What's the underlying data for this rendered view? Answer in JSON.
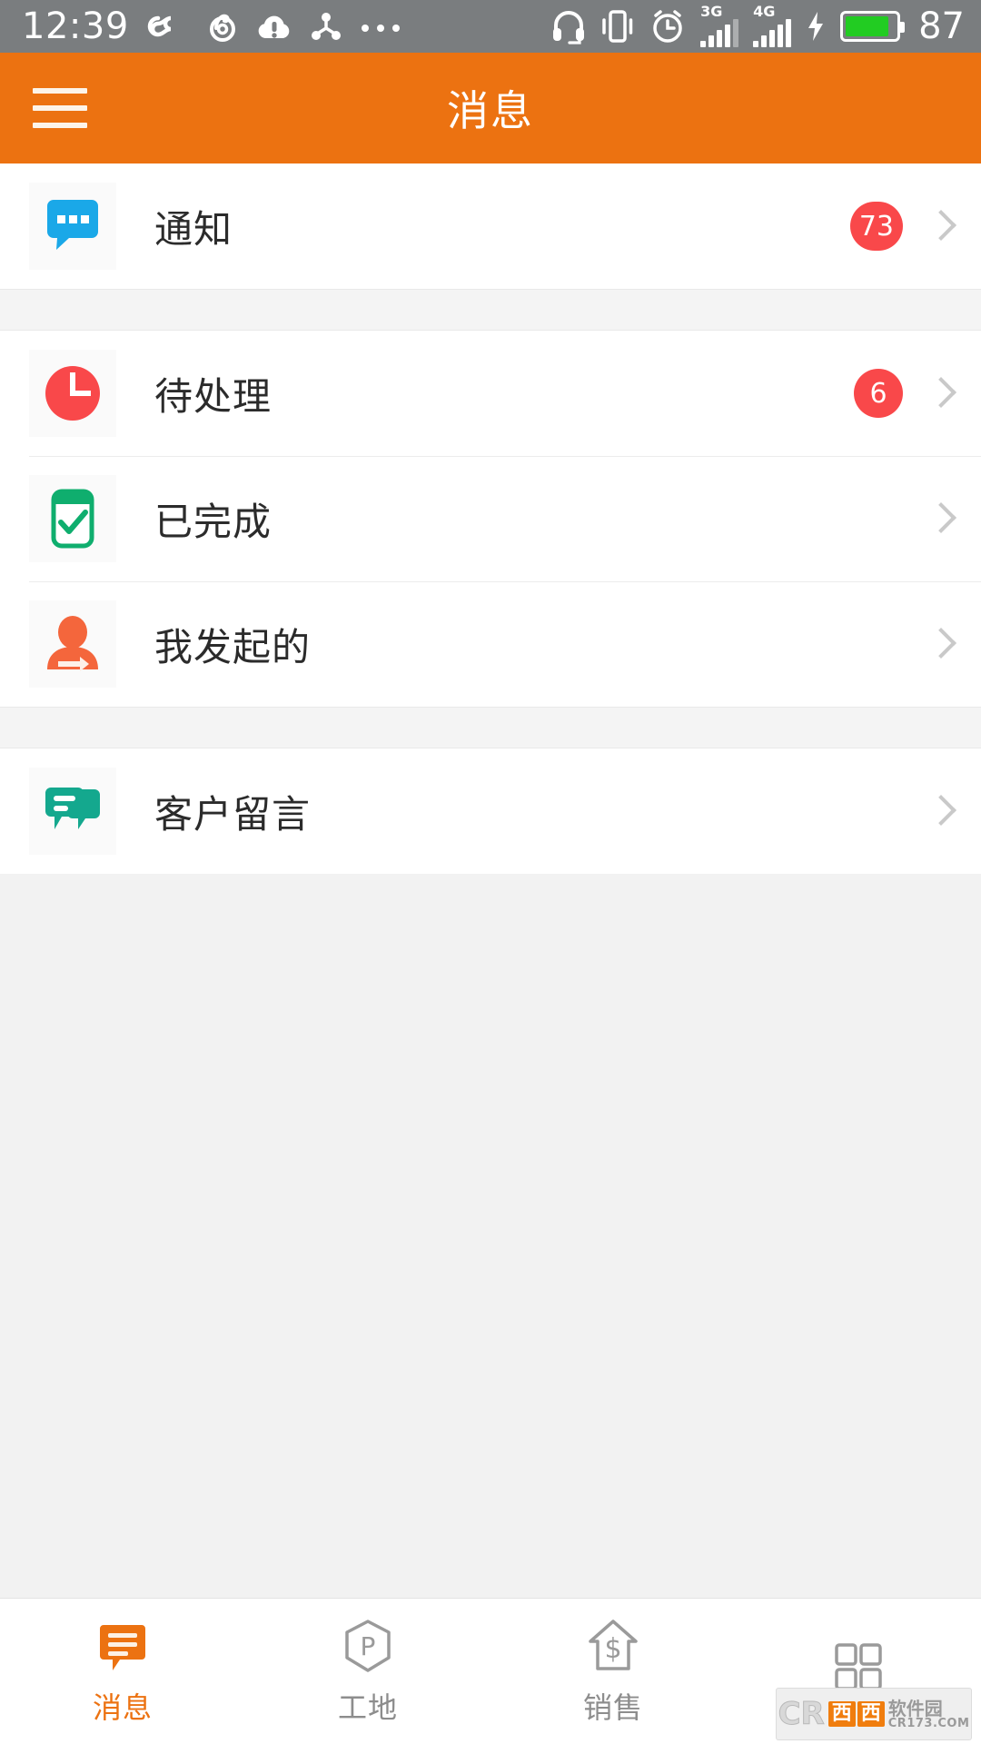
{
  "status_bar": {
    "time": "12:39",
    "battery_percent": "87",
    "left_icons": [
      "infinity-icon",
      "netease-music-icon",
      "cloud-warning-icon",
      "share-network-icon",
      "more-dots-icon"
    ],
    "right_icons": [
      "headset-icon",
      "vibrate-icon",
      "alarm-clock-icon",
      "signal-3g-icon",
      "signal-4g-icon",
      "charging-bolt-icon",
      "battery-icon"
    ],
    "signal_3g_label": "3G",
    "signal_4g_label": "4G",
    "signal_3g_bars": 4,
    "signal_4g_bars": 5,
    "background_color": "#7a7d7f"
  },
  "header": {
    "title": "消息",
    "menu_icon": "hamburger-icon",
    "background_color": "#ec7211",
    "text_color": "#ffffff"
  },
  "list": {
    "groups": [
      {
        "rows": [
          {
            "label": "通知",
            "icon": "blue-message-bubble-icon",
            "icon_color": "#1aa8e8",
            "badge": "73",
            "has_badge": true,
            "chevron": "chevron-right-icon"
          }
        ]
      },
      {
        "rows": [
          {
            "label": "待处理",
            "icon": "red-clock-icon",
            "icon_color": "#f9484a",
            "badge": "6",
            "has_badge": true,
            "chevron": "chevron-right-icon"
          },
          {
            "label": "已完成",
            "icon": "green-checkbox-icon",
            "icon_color": "#0fae6e",
            "badge": "",
            "has_badge": false,
            "chevron": "chevron-right-icon"
          },
          {
            "label": "我发起的",
            "icon": "orange-person-arrow-icon",
            "icon_color": "#f4663c",
            "badge": "",
            "has_badge": false,
            "chevron": "chevron-right-icon"
          }
        ]
      },
      {
        "rows": [
          {
            "label": "客户留言",
            "icon": "teal-double-chat-icon",
            "icon_color": "#14a88e",
            "badge": "",
            "has_badge": false,
            "chevron": "chevron-right-icon"
          }
        ]
      }
    ]
  },
  "tabbar": {
    "active_color": "#ec7211",
    "inactive_color": "#8d8d8d",
    "tabs": [
      {
        "label": "消息",
        "icon": "chat-bubble-lines-icon",
        "active": true
      },
      {
        "label": "工地",
        "icon": "hexagon-p-icon",
        "active": false
      },
      {
        "label": "销售",
        "icon": "shield-dollar-icon",
        "active": false
      },
      {
        "label": "",
        "icon": "grid-squares-icon",
        "active": false
      }
    ]
  },
  "watermark": {
    "brand": "CR",
    "chars": [
      "西",
      "西"
    ],
    "name": "软件园",
    "url": "CR173.COM"
  }
}
